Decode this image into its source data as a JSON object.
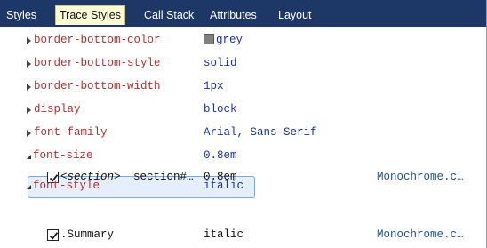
{
  "tabs": [
    {
      "label": "Styles",
      "active": false
    },
    {
      "label": "Trace Styles",
      "active": true
    },
    {
      "label": "Call Stack",
      "active": false
    },
    {
      "label": "Attributes",
      "active": false
    },
    {
      "label": "Layout",
      "active": false
    }
  ],
  "properties": [
    {
      "name": "border-bottom-color",
      "value": "grey",
      "swatch_color": "#808080",
      "state": "collapsed"
    },
    {
      "name": "border-bottom-style",
      "value": "solid",
      "state": "collapsed"
    },
    {
      "name": "border-bottom-width",
      "value": "1px",
      "state": "collapsed"
    },
    {
      "name": "display",
      "value": "block",
      "state": "collapsed"
    },
    {
      "name": "font-family",
      "value": "Arial, Sans-Serif",
      "state": "collapsed"
    },
    {
      "name": "font-size",
      "value": "0.8em",
      "state": "expanded"
    },
    {
      "name": "font-style",
      "value": "italic",
      "state": "expanded",
      "selected": true
    }
  ],
  "traces": [
    {
      "element": "<section>",
      "selector": "section#…",
      "value": "0.8em",
      "source": "Monochrome.c…",
      "checked": true
    },
    {
      "selector": ".Summary",
      "value": "italic",
      "source": "Monochrome.c…",
      "checked": true
    }
  ],
  "colors": {
    "tab_bar": "#1d3867",
    "active_tab": "#fdfdd6",
    "property_name": "#b03030",
    "property_value": "#1a2fa8",
    "selection": "#e5effb"
  }
}
